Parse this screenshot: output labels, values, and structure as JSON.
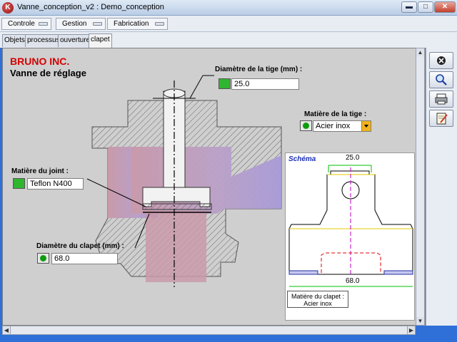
{
  "window": {
    "title": "Vanne_conception_v2 : Demo_conception",
    "app_icon": "K"
  },
  "titlebar": {
    "minimize": "▬",
    "maximize": "□",
    "close": "✕"
  },
  "menu": [
    "Controle",
    "Gestion",
    "Fabrication"
  ],
  "tabs": [
    {
      "label": "Objets",
      "active": false
    },
    {
      "label": "processus",
      "active": false
    },
    {
      "label": "ouverture",
      "active": false
    },
    {
      "label": "clapet",
      "active": true
    }
  ],
  "header": {
    "brand": "BRUNO INC.",
    "subtitle": "Vanne de réglage"
  },
  "fields": {
    "tige": {
      "label": "Diamètre de la tige (mm) :",
      "value": "25.0"
    },
    "matiere_tige": {
      "label": "Matière de la tige :",
      "value": "Acier inox"
    },
    "joint": {
      "label": "Matière du joint :",
      "value": "Teflon N400"
    },
    "clapet": {
      "label": "Diamètre du clapet (mm) :",
      "value": "68.0"
    }
  },
  "schema": {
    "title": "Schéma",
    "top_dim": "25.0",
    "bottom_dim": "68.0",
    "note_line1": "Matière du clapet :",
    "note_line2": "Acier inox"
  },
  "toolbar": [
    {
      "icon": "close-circle-icon",
      "glyph": "⊗"
    },
    {
      "icon": "magnifier-icon",
      "glyph": "🔍"
    },
    {
      "icon": "printer-icon",
      "glyph": "🖨"
    },
    {
      "icon": "edit-note-icon",
      "glyph": "✎"
    }
  ],
  "colors": {
    "brand": "#d40000",
    "schema_title": "#1a2fb8",
    "lock_green": "#2fb62f",
    "dropdown": "#f2b21a"
  }
}
